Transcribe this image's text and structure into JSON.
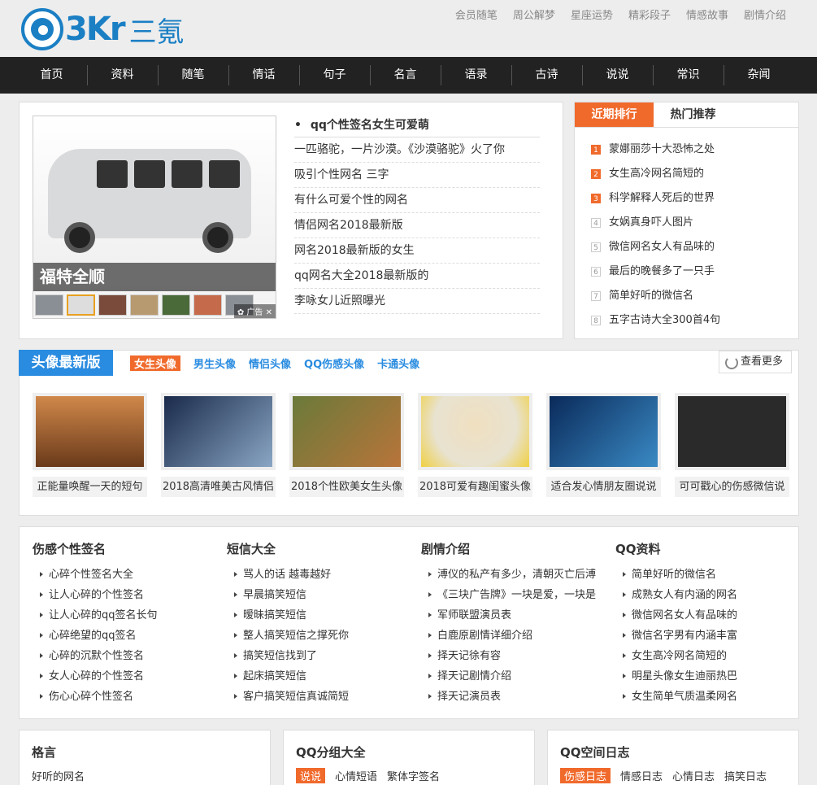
{
  "logo": {
    "text": "3Kr",
    "cn": "三氪"
  },
  "toplinks": [
    "会员随笔",
    "周公解梦",
    "星座运势",
    "精彩段子",
    "情感故事",
    "剧情介绍"
  ],
  "nav": [
    "首页",
    "资料",
    "随笔",
    "情话",
    "句子",
    "名言",
    "语录",
    "古诗",
    "说说",
    "常识",
    "杂闻"
  ],
  "slider": {
    "caption": "福特全顺",
    "ad": "广告"
  },
  "news": {
    "headline": "qq个性签名女生可爱萌",
    "items": [
      "一匹骆驼，一片沙漠。《沙漠骆驼》火了你",
      "吸引个性网名 三字",
      "有什么可爱个性的网名",
      "情侣网名2018最新版",
      "网名2018最新版的女生",
      "qq网名大全2018最新版的",
      "李咏女儿近照曝光"
    ]
  },
  "rank": {
    "tabs": [
      "近期排行",
      "热门推荐"
    ],
    "items": [
      "蒙娜丽莎十大恐怖之处",
      "女生高冷网名简短的",
      "科学解释人死后的世界",
      "女娲真身吓人图片",
      "微信网名女人有品味的",
      "最后的晚餐多了一只手",
      "简单好听的微信名",
      "五字古诗大全300首4句"
    ]
  },
  "avatar": {
    "title": "头像最新版",
    "cats": [
      "女生头像",
      "男生头像",
      "情侣头像",
      "QQ伤感头像",
      "卡通头像"
    ],
    "more": "查看更多",
    "items": [
      {
        "caption": "正能量唤醒一天的短句",
        "color": "#c0622a"
      },
      {
        "caption": "2018高清唯美古风情侣",
        "color": "#4a6a8a"
      },
      {
        "caption": "2018个性欧美女生头像",
        "color": "#8a5a2a"
      },
      {
        "caption": "2018可爱有趣闺蜜头像",
        "color": "#e8e2d0"
      },
      {
        "caption": "适合发心情朋友圈说说",
        "color": "#1c4a7a"
      },
      {
        "caption": "可可戳心的伤感微信说",
        "color": "#2a2a2a"
      }
    ]
  },
  "lists": [
    {
      "title": "伤感个性签名",
      "items": [
        "心碎个性签名大全",
        "让人心碎的个性签名",
        "让人心碎的qq签名长句",
        "心碎绝望的qq签名",
        "心碎的沉默个性签名",
        "女人心碎的个性签名",
        "伤心心碎个性签名"
      ]
    },
    {
      "title": "短信大全",
      "items": [
        "骂人的话 越毒越好",
        "早晨搞笑短信",
        "暧昧搞笑短信",
        "整人搞笑短信之撑死你",
        "搞笑短信找到了",
        "起床搞笑短信",
        "客户搞笑短信真诚简短"
      ]
    },
    {
      "title": "剧情介绍",
      "items": [
        "溥仪的私产有多少，清朝灭亡后溥",
        "《三块广告牌》一块是爱，一块是",
        "军师联盟演员表",
        "白鹿原剧情详细介绍",
        "择天记徐有容",
        "择天记剧情介绍",
        "择天记演员表"
      ]
    },
    {
      "title": "QQ资料",
      "items": [
        "简单好听的微信名",
        "成熟女人有内涵的网名",
        "微信网名女人有品味的",
        "微信名字男有内涵丰富",
        "女生高冷网名简短的",
        "明星头像女生迪丽热巴",
        "女生简单气质温柔网名"
      ]
    }
  ],
  "bottom": [
    {
      "title": "格言",
      "tabs": [
        "好听的网名"
      ],
      "on": -1
    },
    {
      "title": "QQ分组大全",
      "tabs": [
        "说说",
        "心情短语",
        "繁体字签名"
      ],
      "on": 0
    },
    {
      "title": "QQ空间日志",
      "tabs": [
        "伤感日志",
        "情感日志",
        "心情日志",
        "搞笑日志"
      ],
      "on": 0
    }
  ]
}
